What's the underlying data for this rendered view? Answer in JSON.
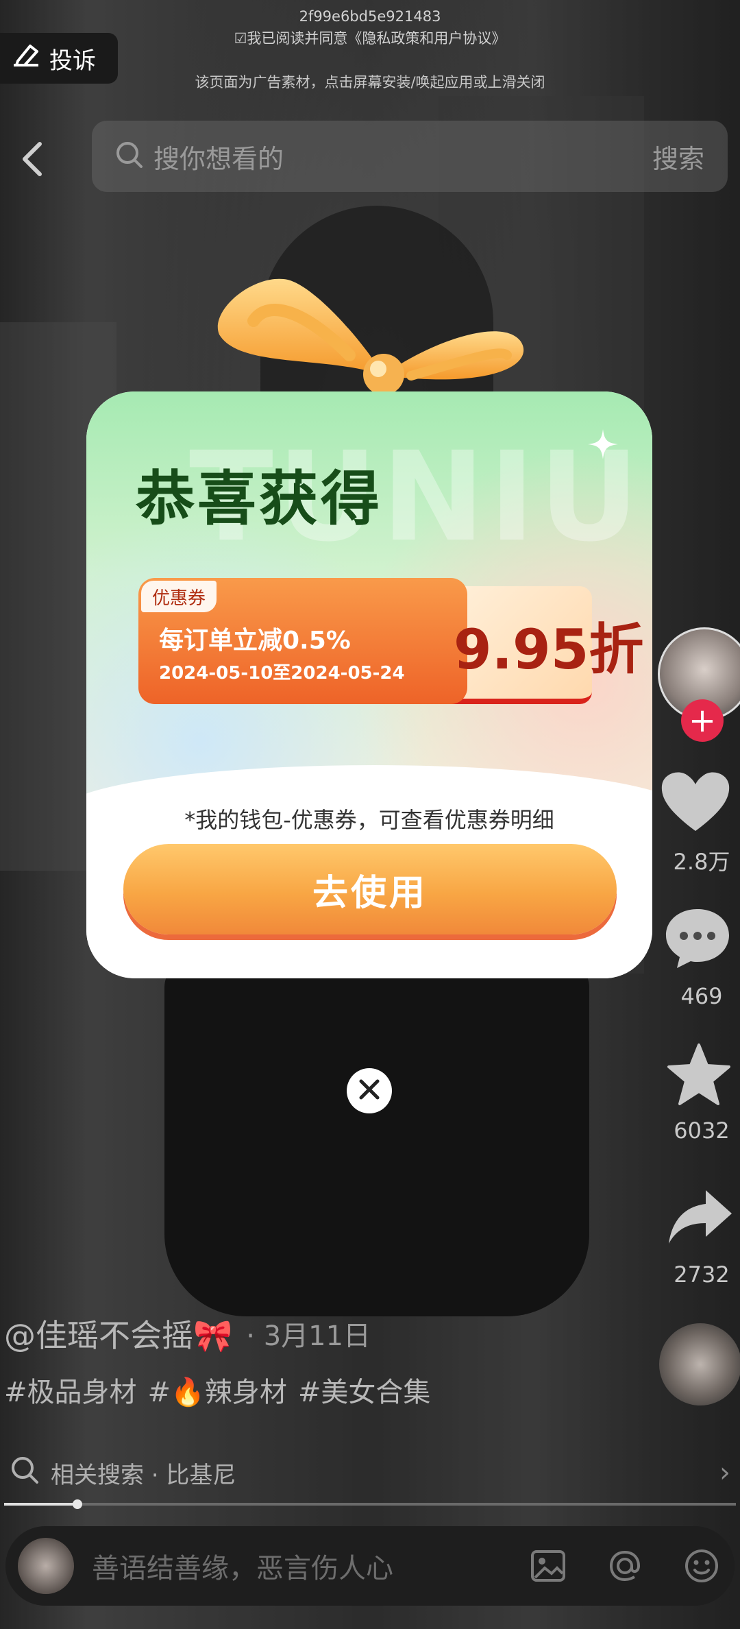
{
  "ad_overlay": {
    "ad_id": "2f99e6bd5e921483",
    "agreement": "☑我已阅读并同意《隐私政策和用户协议》",
    "notice": "该页面为广告素材，点击屏幕安装/唤起应用或上滑关闭",
    "complain_label": "投诉"
  },
  "search": {
    "placeholder": "搜你想看的",
    "button_label": "搜索"
  },
  "popup": {
    "watermark": "TUNIU",
    "title": "恭喜获得",
    "coupon": {
      "tag": "优惠券",
      "desc": "每订单立减0.5%",
      "date_range": "2024-05-10至2024-05-24",
      "discount": "9.95折"
    },
    "hint": "*我的钱包-优惠券，可查看优惠券明细",
    "use_button": "去使用"
  },
  "video": {
    "author": "@佳瑶不会摇🎀",
    "date": "· 3月11日",
    "tags": [
      "#极品身材",
      "#🔥辣身材",
      "#美女合集"
    ],
    "related_search": "相关搜索 · 比基尼",
    "progress": 0.1
  },
  "actions": {
    "likes": "2.8万",
    "comments": "469",
    "favorites": "6032",
    "shares": "2732"
  },
  "comment_bar": {
    "placeholder": "善语结善缘，恶言伤人心"
  },
  "icons": [
    "complain-icon",
    "back-icon",
    "search-icon",
    "heart-icon",
    "comment-icon",
    "star-icon",
    "share-icon",
    "close-icon",
    "image-icon",
    "at-icon",
    "emoji-icon",
    "chevron-right-icon"
  ]
}
